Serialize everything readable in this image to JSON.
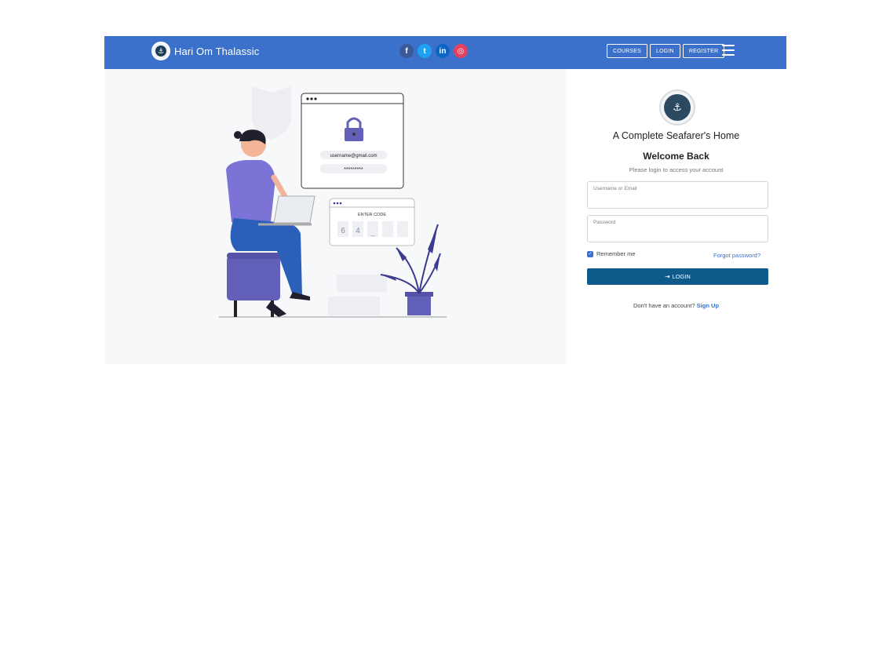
{
  "navbar": {
    "brand_name": "Hari Om Thalassic",
    "socials": [
      {
        "name": "facebook",
        "glyph": "f"
      },
      {
        "name": "twitter",
        "glyph": "t"
      },
      {
        "name": "linkedin",
        "glyph": "in"
      },
      {
        "name": "instagram",
        "glyph": "◎"
      }
    ],
    "buttons": {
      "courses": "COURSES",
      "login": "LOGIN",
      "register": "REGISTER"
    },
    "accent_color": "#3b71cb"
  },
  "illustration": {
    "card_email": "username@gmail.com",
    "card_password": "*********",
    "code_title": "ENTER CODE",
    "code_digits": [
      "6",
      "4",
      "_",
      "",
      ""
    ]
  },
  "login": {
    "tagline": "A Complete Seafarer's Home",
    "welcome": "Welcome Back",
    "subtext": "Please login to access your account",
    "username_label": "Username or Email",
    "password_label": "Password",
    "remember_label": "Remember me",
    "forgot_label": "Forgot password?",
    "login_button": "LOGIN",
    "no_account_text": "Don't have an account?",
    "signup_link": "Sign Up",
    "button_color": "#0e5a8a"
  }
}
